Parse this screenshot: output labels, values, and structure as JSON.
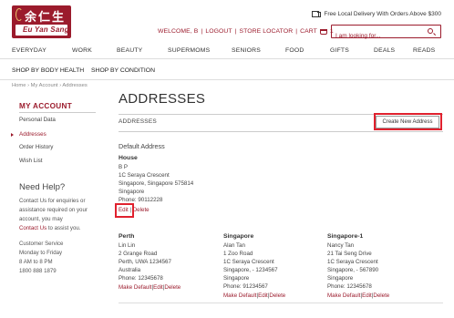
{
  "brand": {
    "name_cn": "余仁生",
    "name_en": "Eu Yan Sang",
    "color": "#9b1b2c"
  },
  "header": {
    "delivery": "Free Local Delivery With Orders Above $300",
    "welcome": "WELCOME, B",
    "logout": "LOGOUT",
    "store_locator": "STORE LOCATOR",
    "cart_label": "CART",
    "cart_count": "1",
    "search_placeholder": "I am looking for..."
  },
  "nav": {
    "items": [
      "EVERYDAY",
      "WORK",
      "BEAUTY",
      "SUPERMOMS",
      "SENIORS",
      "FOOD",
      "GIFTS",
      "DEALS",
      "READS"
    ],
    "sub": [
      "SHOP BY BODY HEALTH",
      "SHOP BY CONDITION"
    ]
  },
  "breadcrumb": "Home › My Account › Addresses",
  "sidebar": {
    "title": "MY ACCOUNT",
    "items": [
      "Personal Data",
      "Addresses",
      "Order History",
      "Wish List"
    ],
    "help_title": "Need Help?",
    "help_lines": [
      "Contact Us for enquiries or",
      "assistance required on your",
      "account, you may"
    ],
    "help_link": "Contact Us",
    "help_link_suffix": " to assist you.",
    "service_lines": [
      "Customer Service",
      "Monday to Friday",
      "8 AM to 8 PM",
      "1800 888 1879"
    ]
  },
  "main": {
    "title": "ADDRESSES",
    "section_label": "ADDRESSES",
    "create_button": "Create New Address",
    "default_label": "Default Address",
    "default_address": {
      "name": "House",
      "lines": [
        "B P",
        "1C Seraya Crescent",
        "Singapore, Singapore 575814",
        "Singapore",
        "Phone: 90112228"
      ],
      "edit": "Edit",
      "delete": "Delete"
    },
    "addresses": [
      {
        "name": "Perth",
        "lines": [
          "Lin Lin",
          "2 Grange Road",
          "Perth, UWA 1234567",
          "Australia",
          "Phone: 12345678"
        ],
        "make_default": "Make Default",
        "edit": "Edit",
        "delete": "Delete"
      },
      {
        "name": "Singapore",
        "lines": [
          "Alan Tan",
          "1 Zoo Road",
          "1C Seraya Crescent",
          "Singapore, - 1234567",
          "Singapore",
          "Phone: 91234567"
        ],
        "make_default": "Make Default",
        "edit": "Edit",
        "delete": "Delete"
      },
      {
        "name": "Singapore-1",
        "lines": [
          "Nancy Tan",
          "21 Tai Seng Drive",
          "1C Seraya Crescent",
          "Singapore, - 567890",
          "Singapore",
          "Phone: 12345678"
        ],
        "make_default": "Make Default",
        "edit": "Edit",
        "delete": "Delete"
      }
    ]
  }
}
